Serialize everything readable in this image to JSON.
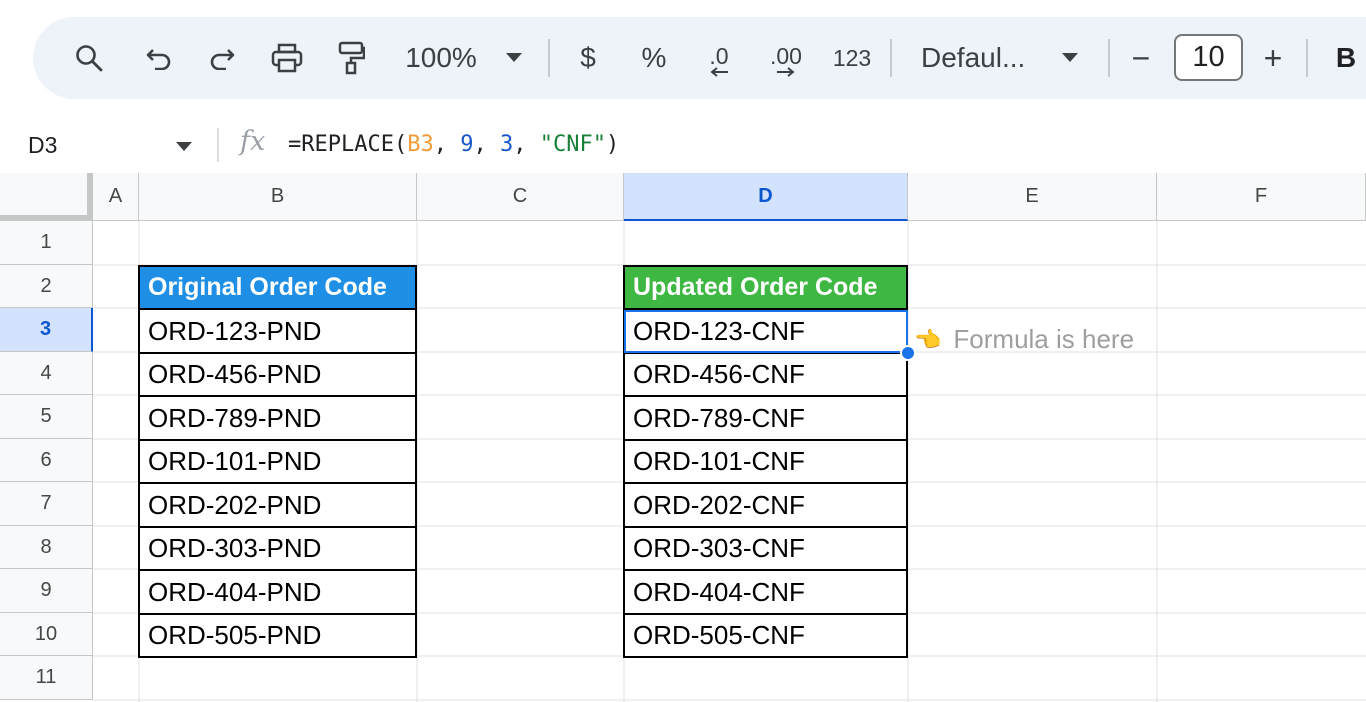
{
  "toolbar": {
    "zoom": "100%",
    "currency": "$",
    "percent": "%",
    "decrease_decimal": ".0",
    "increase_decimal": ".00",
    "more_formats": "123",
    "font": "Defaul...",
    "font_size": "10",
    "minus": "−",
    "plus": "+",
    "bold": "B"
  },
  "formula_bar": {
    "cell_ref": "D3",
    "fx": "fx",
    "formula_prefix": "=REPLACE(",
    "formula_ref": "B3",
    "formula_sep1": ", ",
    "formula_arg2": "9",
    "formula_sep2": ", ",
    "formula_arg3": "3",
    "formula_sep3": ", ",
    "formula_arg4": "\"CNF\"",
    "formula_suffix": ")"
  },
  "columns": [
    "A",
    "B",
    "C",
    "D",
    "E",
    "F"
  ],
  "rows": [
    "1",
    "2",
    "3",
    "4",
    "5",
    "6",
    "7",
    "8",
    "9",
    "10",
    "11"
  ],
  "table_original": {
    "header": "Original Order Code",
    "values": [
      "ORD-123-PND",
      "ORD-456-PND",
      "ORD-789-PND",
      "ORD-101-PND",
      "ORD-202-PND",
      "ORD-303-PND",
      "ORD-404-PND",
      "ORD-505-PND"
    ]
  },
  "table_updated": {
    "header": "Updated Order Code",
    "values": [
      "ORD-123-CNF",
      "ORD-456-CNF",
      "ORD-789-CNF",
      "ORD-101-CNF",
      "ORD-202-CNF",
      "ORD-303-CNF",
      "ORD-404-CNF",
      "ORD-505-CNF"
    ]
  },
  "note": {
    "icon": "👈",
    "text": "Formula is here"
  },
  "colors": {
    "header_original": "#1f8fe6",
    "header_updated": "#3fb743",
    "selection": "#1a73e8"
  }
}
